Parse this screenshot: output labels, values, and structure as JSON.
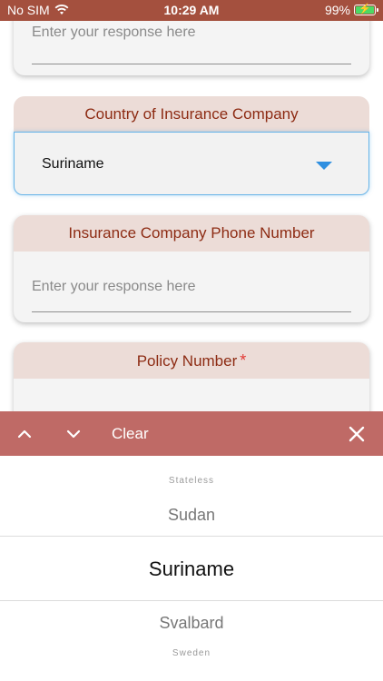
{
  "status_bar": {
    "carrier": "No SIM",
    "time": "10:29 AM",
    "battery_text": "99%"
  },
  "form": {
    "card1": {
      "placeholder": "Enter your response here"
    },
    "country": {
      "title": "Country of Insurance Company",
      "value": "Suriname"
    },
    "phone": {
      "title": "Insurance Company Phone Number",
      "placeholder": "Enter your response here"
    },
    "policy": {
      "title": "Policy Number",
      "required_mark": "*"
    }
  },
  "toolbar": {
    "clear_label": "Clear"
  },
  "picker": {
    "options": [
      "Stateless",
      "Sudan",
      "Suriname",
      "Svalbard",
      "Sweden"
    ],
    "selected": "Suriname"
  },
  "colors": {
    "accent": "#a4503e",
    "header_text": "#8d2b13",
    "toolbar": "#bf6a66",
    "focus": "#67b4e8",
    "caret": "#2f8fe0"
  }
}
